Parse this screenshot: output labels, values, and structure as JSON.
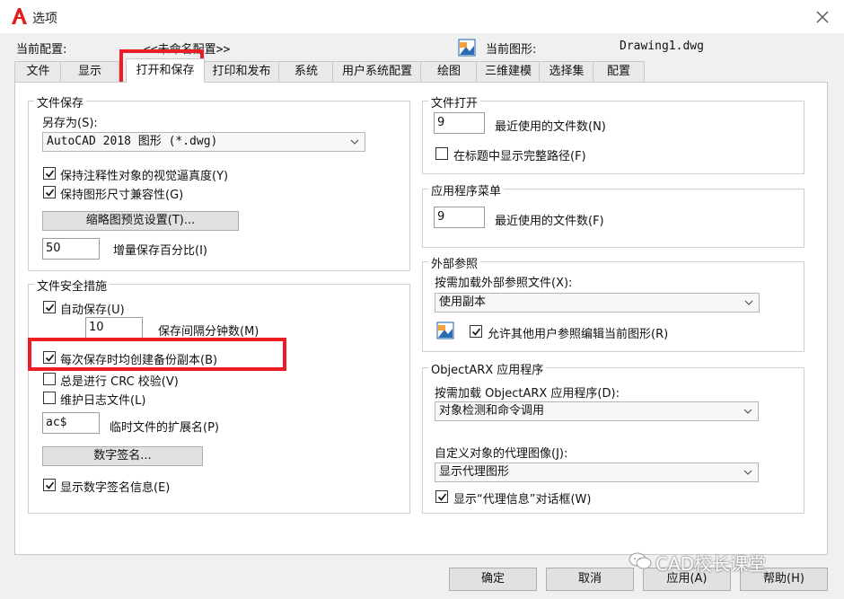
{
  "window": {
    "title": "选项",
    "close_label": "×"
  },
  "header": {
    "profile_label": "当前配置:",
    "profile_value": "<<未命名配置>>",
    "drawing_label": "当前图形:",
    "drawing_value": "Drawing1.dwg"
  },
  "tabs": [
    "文件",
    "显示",
    "打开和保存",
    "打印和发布",
    "系统",
    "用户系统配置",
    "绘图",
    "三维建模",
    "选择集",
    "配置"
  ],
  "active_tab": "打开和保存",
  "file_save": {
    "title": "文件保存",
    "save_as_label": "另存为(S):",
    "save_as_value": "AutoCAD 2018 图形 (*.dwg)",
    "keep_annotative_label": "保持注释性对象的视觉逼真度(Y)",
    "keep_annotative_checked": true,
    "keep_size_compat_label": "保持图形尺寸兼容性(G)",
    "keep_size_compat_checked": true,
    "thumbnail_button": "缩略图预览设置(T)...",
    "incremental_value": "50",
    "incremental_label": "增量保存百分比(I)"
  },
  "file_safety": {
    "title": "文件安全措施",
    "autosave_label": "自动保存(U)",
    "autosave_checked": true,
    "minutes_value": "10",
    "minutes_label": "保存间隔分钟数(M)",
    "backup_label": "每次保存时均创建备份副本(B)",
    "backup_checked": true,
    "crc_label": "总是进行 CRC 校验(V)",
    "crc_checked": false,
    "log_label": "维护日志文件(L)",
    "log_checked": false,
    "temp_ext_value": "ac$",
    "temp_ext_label": "临时文件的扩展名(P)",
    "digital_sign_button": "数字签名...",
    "show_sign_label": "显示数字签名信息(E)",
    "show_sign_checked": true
  },
  "file_open": {
    "title": "文件打开",
    "recent_value": "9",
    "recent_label": "最近使用的文件数(N)",
    "fullpath_label": "在标题中显示完整路径(F)",
    "fullpath_checked": false
  },
  "app_menu": {
    "title": "应用程序菜单",
    "recent_value": "9",
    "recent_label": "最近使用的文件数(F)"
  },
  "xref": {
    "title": "外部参照",
    "demand_label": "按需加载外部参照文件(X):",
    "demand_value": "使用副本",
    "allow_edit_label": "允许其他用户参照编辑当前图形(R)",
    "allow_edit_checked": true
  },
  "objectarx": {
    "title": "ObjectARX 应用程序",
    "demand_label": "按需加载 ObjectARX 应用程序(D):",
    "demand_value": "对象检测和命令调用",
    "proxy_label": "自定义对象的代理图像(J):",
    "proxy_value": "显示代理图形",
    "proxy_dialog_label": "显示“代理信息”对话框(W)",
    "proxy_dialog_checked": true
  },
  "buttons": {
    "ok": "确定",
    "cancel": "取消",
    "apply": "应用(A)",
    "help": "帮助(H)"
  },
  "watermark": "CAD校长课堂",
  "colors": {
    "highlight": "#ee1c25",
    "autocad_red": "#e02020"
  }
}
